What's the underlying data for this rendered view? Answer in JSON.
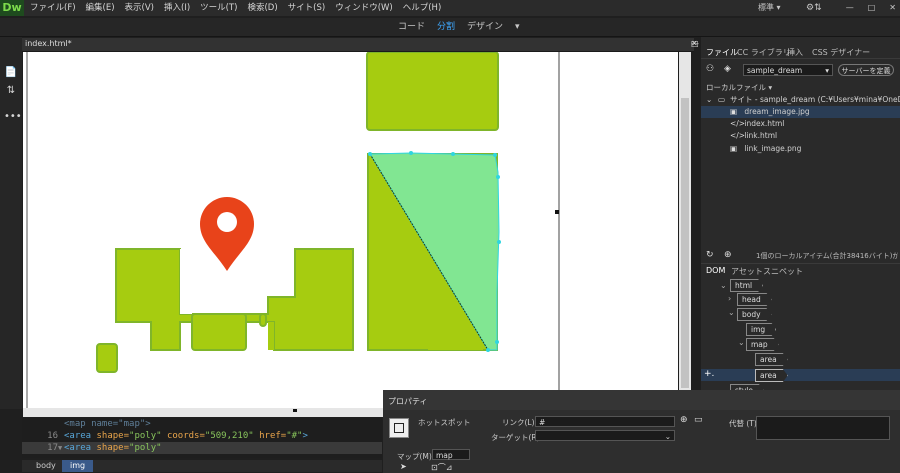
{
  "app": {
    "logo": "Dw",
    "workspace": "標準 ▾",
    "sync_icon": "sync-icon"
  },
  "menu": [
    "ファイル(F)",
    "編集(E)",
    "表示(V)",
    "挿入(I)",
    "ツール(T)",
    "検索(D)",
    "サイト(S)",
    "ウィンドウ(W)",
    "ヘルプ(H)"
  ],
  "window_controls": {
    "min": "—",
    "max": "□",
    "close": "✕"
  },
  "view_tabs": {
    "code": "コード",
    "split": "分割",
    "design": "デザイン",
    "dropdown": "▾"
  },
  "document": {
    "tab_title": "index.html*"
  },
  "left_tools": {
    "t1": "📄",
    "t2": "⇅",
    "t3": "•••"
  },
  "code_lines": [
    {
      "num": "",
      "text": "<map name=\"map\">"
    },
    {
      "num": "16",
      "tag_open": "<area",
      "attr1": " shape=",
      "val1": "\"poly\"",
      "attr2": " coords=",
      "val2": "\"509,210\"",
      "attr3": " href=",
      "val3": "\"#\"",
      "tag_close": ">"
    },
    {
      "num": "17",
      "fold": "▼",
      "tag_open": "<area",
      "attr1": " shape=",
      "val1": "\"poly\""
    }
  ],
  "breadcrumbs": [
    "body",
    "img"
  ],
  "right_panel": {
    "tabs": [
      "ファイル",
      "CC ライブラリ",
      "挿入",
      "CSS デザイナー"
    ],
    "site_select": "sample_dream",
    "server_button": "サーバーを定義",
    "local_files_label": "ローカルファイル ▾",
    "site_root": "サイト - sample_dream (C:¥Users¥mina¥OneDriv...",
    "files": [
      {
        "icon": "image-file-icon",
        "glyph": "▣",
        "name": "dream_image.jpg"
      },
      {
        "icon": "code-file-icon",
        "glyph": "</>",
        "name": "index.html"
      },
      {
        "icon": "code-file-icon",
        "glyph": "</>",
        "name": "link.html"
      },
      {
        "icon": "image-file-icon",
        "glyph": "▣",
        "name": "link_image.png"
      }
    ],
    "file_status": "1個のローカルアイテム(合計38416バイト)が選...",
    "dom_tabs": [
      "DOM",
      "アセット",
      "スニペット"
    ],
    "dom_nodes": [
      "html",
      "head",
      "body",
      "img",
      "map",
      "area",
      "area",
      "style"
    ]
  },
  "properties": {
    "title": "プロパティ",
    "hotspot_label": "ホットスポット",
    "link_label": "リンク(L)",
    "link_value": "#",
    "target_label": "ターゲット(R)",
    "alt_label": "代替 (T)",
    "map_label": "マップ(M)",
    "map_value": "map"
  },
  "colors": {
    "accent": "#3fa9ff",
    "map_green": "#a6cc10",
    "map_green_edge": "#7fb52a",
    "pin": "#e8431a",
    "hotspot_fill": "#7ee79a",
    "hotspot_edge": "#2fd6e0",
    "selection": "#2a3d55"
  }
}
